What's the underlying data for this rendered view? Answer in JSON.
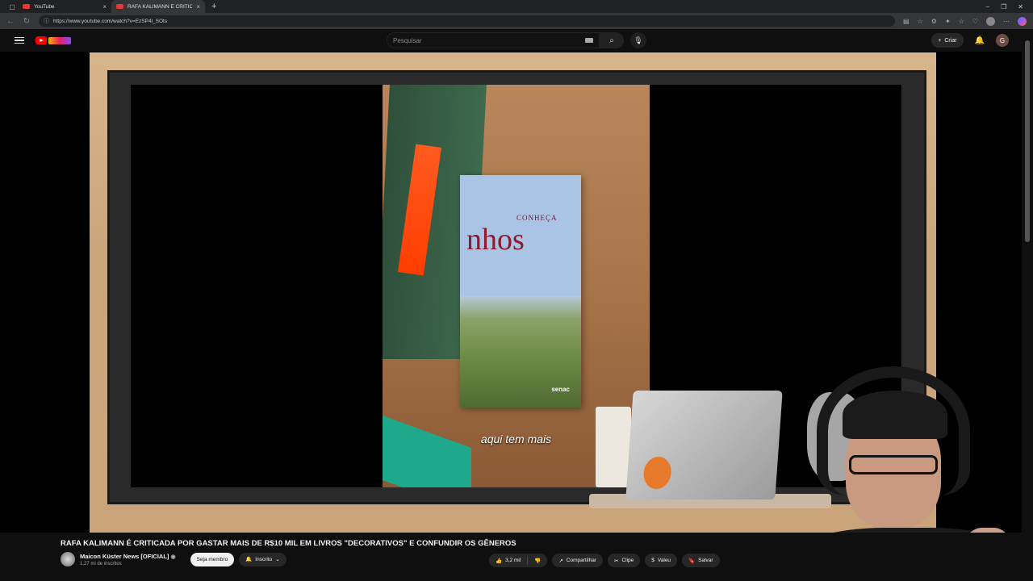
{
  "browser": {
    "tabs": [
      {
        "title": "YouTube",
        "active": false
      },
      {
        "title": "RAFA KALIMANN É CRITICA",
        "active": true
      }
    ],
    "url": "https://www.youtube.com/watch?v=EzSP4l_SOts",
    "new_tab_icon": "plus-icon"
  },
  "header": {
    "search_placeholder": "Pesquisar",
    "create_label": "Criar",
    "profile_initial": "G"
  },
  "player": {
    "subtitle": "aqui tem mais",
    "book_title_small": "CONHEÇA",
    "book_title_large": "nhos",
    "book_publisher": "senac"
  },
  "video": {
    "title": "RAFA KALIMANN É CRITICADA POR GASTAR MAIS DE R$10 MIL EM LIVROS \"DECORATIVOS\" E CONFUNDIR OS GÊNEROS",
    "channel_name": "Maicon Küster News [OFICIAL]",
    "subscribers": "1,27 mi de inscritos",
    "join_label": "Seja membro",
    "subscribed_label": "Inscrito",
    "likes": "3,2 mil",
    "share_label": "Compartilhar",
    "clip_label": "Clipe",
    "thanks_label": "Valeu",
    "save_label": "Salvar"
  },
  "colors": {
    "accent": "#ff0000",
    "background": "#0f0f0f"
  }
}
